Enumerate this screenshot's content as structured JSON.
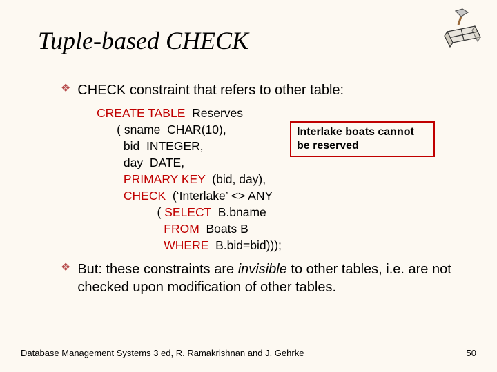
{
  "title": "Tuple-based CHECK",
  "bullets": {
    "b1": "CHECK constraint that refers to other table:",
    "b2_pre": "But: these constraints are ",
    "b2_em": "invisible",
    "b2_post": " to other tables, i.e. are not checked upon modification of other tables."
  },
  "code": {
    "l1_kw": "CREATE TABLE",
    "l1_rest": "  Reserves",
    "l2": "      ( sname  CHAR(10),",
    "l3": "        bid  INTEGER,",
    "l4": "        day  DATE,",
    "l5_kw": "PRIMARY KEY",
    "l5_rest": "  (bid, day),",
    "l6_kw": "CHECK",
    "l6_rest": "  (‘Interlake’ <> ANY",
    "l7_kw": "SELECT",
    "l7_rest": "  B.bname",
    "l8_kw": "FROM",
    "l8_rest": "  Boats B",
    "l9_kw": "WHERE",
    "l9_rest": "  B.bid=bid)));"
  },
  "callout": "Interlake boats cannot be reserved",
  "footer": {
    "left": "Database Management Systems 3 ed,  R. Ramakrishnan and J. Gehrke",
    "page": "50"
  }
}
